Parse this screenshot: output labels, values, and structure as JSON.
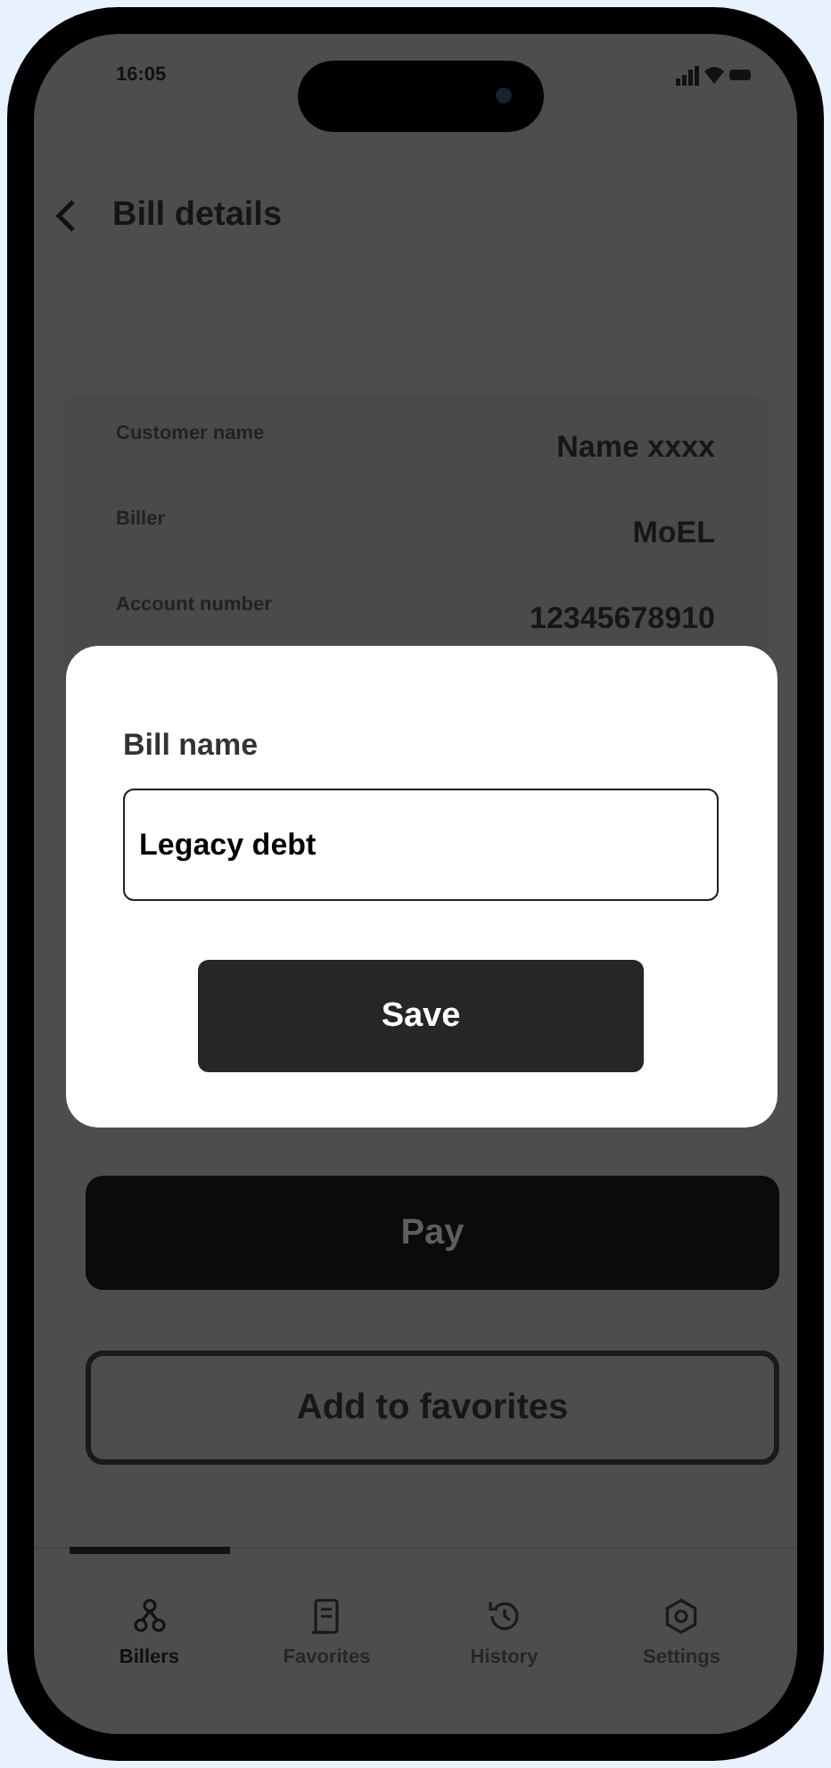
{
  "status_bar": {
    "time": "16:05"
  },
  "header": {
    "title": "Bill details"
  },
  "details": [
    {
      "label": "Customer name",
      "value": "Name xxxx"
    },
    {
      "label": "Biller",
      "value": "MoEL"
    },
    {
      "label": "Account number",
      "value": "12345678910"
    }
  ],
  "buttons": [
    {
      "label": "Pay",
      "kind": "primary"
    },
    {
      "label": "Add to favorites",
      "kind": "outline"
    }
  ],
  "tabs": [
    {
      "label": "Billers",
      "kind": "billers",
      "selected": true
    },
    {
      "label": "Favorites",
      "kind": "favorites",
      "selected": false
    },
    {
      "label": "History",
      "kind": "history",
      "selected": false
    },
    {
      "label": "Settings",
      "kind": "settings",
      "selected": false
    }
  ],
  "dialog": {
    "field_label": "Bill name",
    "field_value": "Legacy debt",
    "button": "Save"
  }
}
